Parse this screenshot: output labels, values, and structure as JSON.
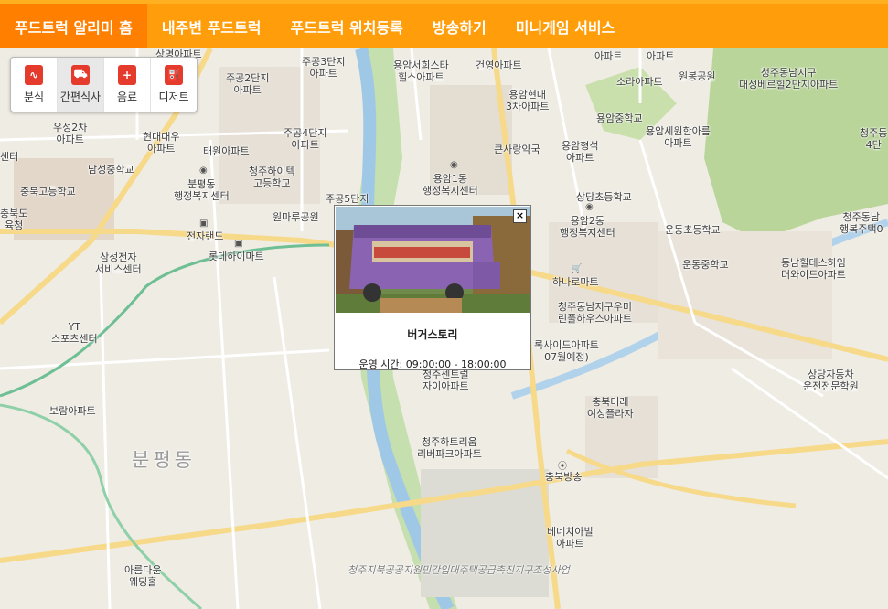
{
  "nav": {
    "items": [
      "푸드트럭 알리미 홈",
      "내주변 푸드트럭",
      "푸드트럭 위치등록",
      "방송하기",
      "미니게임 서비스"
    ]
  },
  "categories": [
    {
      "label": "분식",
      "icon": "wave-icon"
    },
    {
      "label": "간편식사",
      "icon": "cart-icon"
    },
    {
      "label": "음료",
      "icon": "plus-icon"
    },
    {
      "label": "디저트",
      "icon": "fuel-icon"
    }
  ],
  "popup": {
    "name": "버거스토리",
    "hours": "운영 시간: 09:00:00 - 18:00:00",
    "close": "×"
  },
  "map": {
    "labels": [
      "상명아파트",
      "주공2단지\n아파트",
      "주공3단지\n아파트",
      "용암서희스타\n힐스아파트",
      "건영아파트",
      "아파트",
      "아파트",
      "원봉공원",
      "청주동남지구\n대성베르힐2단지아파트",
      "소라아파트",
      "용암현대\n3차아파트",
      "용암중학교",
      "용암세원한아름\n아파트",
      "청주동\n4단",
      "우성2차\n아파트",
      "현대대우\n아파트",
      "태원아파트",
      "주공4단지\n아파트",
      "큰사랑약국",
      "용암형석\n아파트",
      "센터",
      "남성중학교",
      "충북고등학교",
      "분평동\n행정복지센터",
      "청주하이텍\n고등학교",
      "용암1동\n행정복지센터",
      "상당초등학교",
      "충북도\n육청",
      "주공5단지",
      "원마루공원",
      "용암2동\n행정복지센터",
      "운동초등학교",
      "청주동남\n행복주택0",
      "전자랜드",
      "롯데하이마트",
      "삼성전자\n서비스센터",
      "하나로마트",
      "운동중학교",
      "동남힐데스하임\n더와이드아파트",
      "청주동남지구우미\n린풀하우스아파트",
      "YT\n스포츠센터",
      "록사이드아파트\n07월예정)",
      "상당자동차\n운전전문학원",
      "청주센트럴\n자이아파트",
      "보람아파트",
      "충북미래\n여성플라자",
      "청주하트리움\n리버파크아파트",
      "충북방송",
      "분평동",
      "베네치아빌\n아파트",
      "아름다운\n웨딩홀",
      "청주지북공공지원민간임대주택공급촉진지구조성사업"
    ]
  }
}
